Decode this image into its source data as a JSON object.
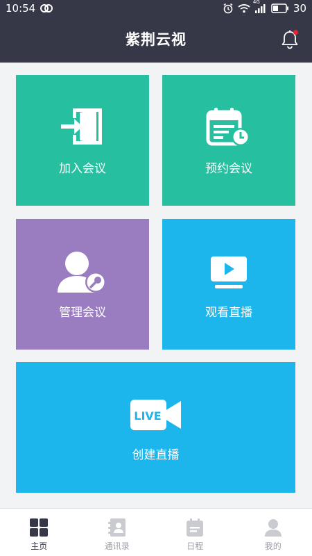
{
  "status_bar": {
    "time": "10:54",
    "network": "4G",
    "battery": "30"
  },
  "header": {
    "title": "紫荆云视",
    "has_notification": true
  },
  "tiles": {
    "join": "加入会议",
    "schedule": "预约会议",
    "manage": "管理会议",
    "watch": "观看直播",
    "create": "创建直播",
    "create_icon_text": "LIVE"
  },
  "tab_bar": {
    "home": "主页",
    "contacts": "通讯录",
    "schedule": "日程",
    "me": "我的",
    "active": "home"
  },
  "colors": {
    "header_bg": "#363848",
    "green_tile": "#26bfa0",
    "purple_tile": "#9a7cc1",
    "blue_tile": "#1cb6ec",
    "notification_dot": "#e8222e"
  }
}
